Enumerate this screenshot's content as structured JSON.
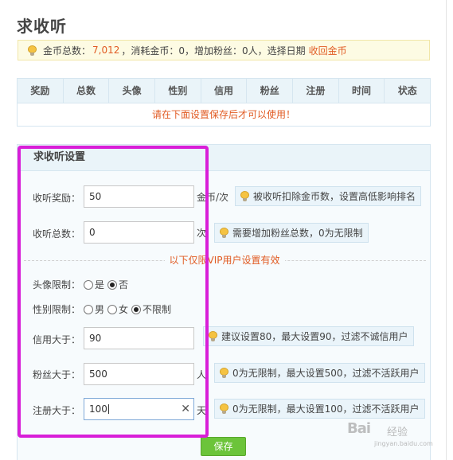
{
  "page_title": "求收听",
  "summary": {
    "coins_label": "金币总数：",
    "coins_value": "7,012",
    "rest": "，消耗金币：0，增加粉丝：0人，选择日期",
    "recover_link": "收回金币"
  },
  "table": {
    "headers": [
      "奖励",
      "总数",
      "头像",
      "性别",
      "信用",
      "粉丝",
      "注册",
      "时间",
      "状态"
    ],
    "notice": "请在下面设置保存后才可以使用！"
  },
  "settings": {
    "title": "求收听设置",
    "reward": {
      "label": "收听奖励：",
      "value": "50",
      "unit": "金币/次",
      "hint": "被收听扣除金币数，设置高低影响排名"
    },
    "total": {
      "label": "收听总数：",
      "value": "0",
      "unit": "次",
      "hint": "需要增加粉丝总数，0为无限制"
    },
    "vip_notice": "以下仅限VIP用户设置有效",
    "avatar": {
      "label": "头像限制：",
      "options": [
        "是",
        "否"
      ],
      "selected": "否"
    },
    "gender": {
      "label": "性别限制：",
      "options": [
        "男",
        "女",
        "不限制"
      ],
      "selected": "不限制"
    },
    "credit": {
      "label": "信用大于：",
      "value": "90",
      "hint": "建议设置80，最大设置90，过滤不诚信用户"
    },
    "fans": {
      "label": "粉丝大于：",
      "value": "500",
      "unit": "人",
      "hint": "0为无限制，最大设置500，过滤不活跃用户"
    },
    "register": {
      "label": "注册大于：",
      "value": "100",
      "unit": "天",
      "hint": "0为无限制，最大设置100，过滤不活跃用户"
    },
    "save_label": "保存"
  },
  "watermark": {
    "brand": "Bai",
    "brand_suffix": "经验",
    "url": "jingyan.baidu.com"
  },
  "colors": {
    "accent_orange": "#e15b23",
    "highlight_magenta": "#d81ed8",
    "save_green": "#6cc43a"
  }
}
